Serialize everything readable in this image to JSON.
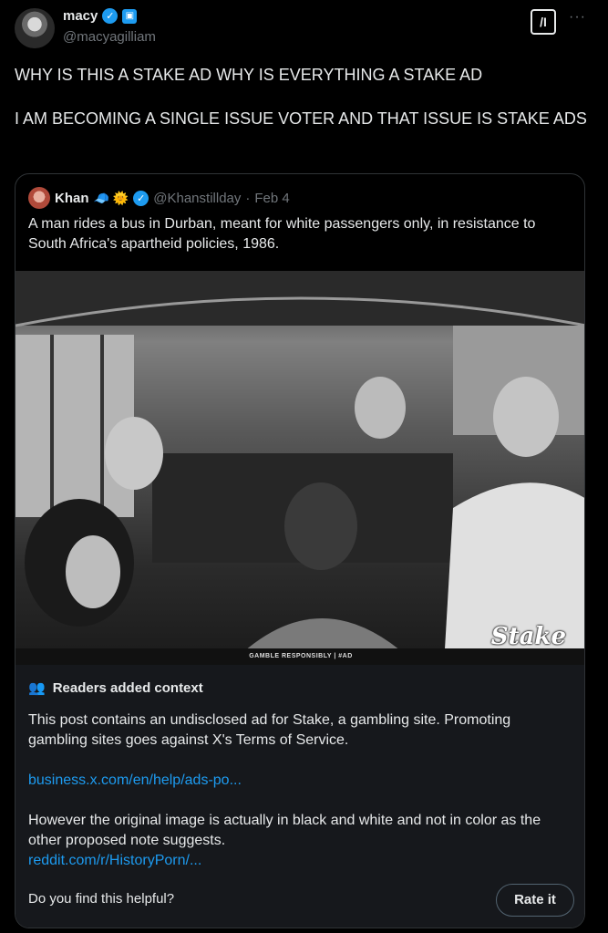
{
  "author": {
    "display_name": "macy",
    "handle": "@macyagilliam"
  },
  "tweet": {
    "text": "WHY IS THIS A STAKE AD WHY IS EVERYTHING A STAKE AD\n\nI AM BECOMING A SINGLE ISSUE VOTER AND THAT ISSUE IS STAKE ADS"
  },
  "quoted": {
    "display_name": "Khan",
    "emojis": "🧢 🌞",
    "handle": "@Khanstillday",
    "separator": "·",
    "date": "Feb 4",
    "text": "A man rides a bus in Durban, meant for white passengers only, in resistance to South Africa's apartheid policies, 1986.",
    "image_caption": "GAMBLE RESPONSIBLY  |  #AD",
    "image_logo": "Stake"
  },
  "community_note": {
    "title": "Readers added context",
    "body1": "This post contains an undisclosed ad for Stake, a gambling site. Promoting gambling sites goes against X's Terms of Service.",
    "link1": "business.x.com/en/help/ads-po...",
    "body2": "However the original image is actually in black and white and not in color as the other proposed note suggests.",
    "link2": "reddit.com/r/HistoryPorn/...",
    "prompt": "Do you find this helpful?",
    "rate_label": "Rate it"
  },
  "icons": {
    "verified": "✓",
    "affiliate": "▣",
    "grok": "/I",
    "more": "···",
    "people": "👥"
  },
  "colors": {
    "background": "#000000",
    "accent": "#1d9bf0",
    "text": "#e7e9ea",
    "muted": "#71767b",
    "note_bg": "#16181c"
  }
}
